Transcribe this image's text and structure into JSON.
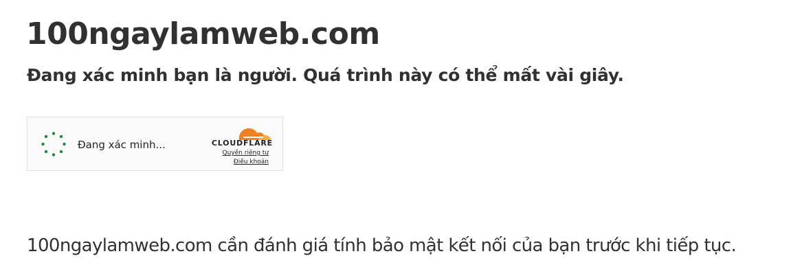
{
  "page": {
    "site_title": "100ngaylamweb.com",
    "subtitle": "Đang xác minh bạn là người. Quá trình này có thể mất vài giây.",
    "footer": "100ngaylamweb.com cần đánh giá tính bảo mật kết nối của bạn trước khi tiếp tục."
  },
  "widget": {
    "status_text": "Đang xác minh...",
    "brand": "CLOUDFLARE",
    "privacy_link": "Quyền riêng tư",
    "terms_link": "Điều khoản",
    "spinner_color": "#1a8a3a",
    "brand_orange": "#f38020",
    "brand_light_orange": "#faae40",
    "icons": {
      "spinner": "loading-spinner-icon",
      "logo": "cloudflare-cloud-icon"
    }
  }
}
